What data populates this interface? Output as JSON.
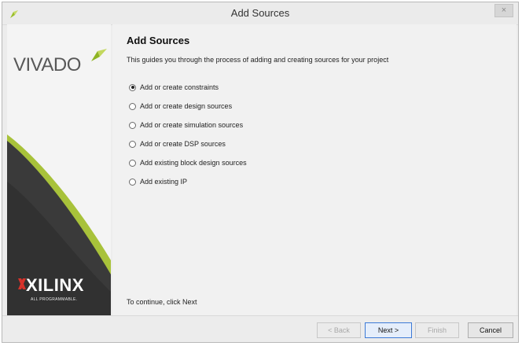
{
  "window": {
    "title": "Add Sources",
    "close_label": "×"
  },
  "branding": {
    "vivado_label": "VIVADO",
    "xilinx_label": "XILINX",
    "xilinx_tagline": "ALL PROGRAMMABLE."
  },
  "page": {
    "heading": "Add Sources",
    "subtitle": "This guides you through the process of adding and creating sources for your project",
    "continue_hint": "To continue, click Next"
  },
  "options": [
    {
      "label": "Add or create constraints",
      "checked": true
    },
    {
      "label": "Add or create design sources",
      "checked": false
    },
    {
      "label": "Add or create simulation sources",
      "checked": false
    },
    {
      "label": "Add or create DSP sources",
      "checked": false
    },
    {
      "label": "Add existing block design sources",
      "checked": false
    },
    {
      "label": "Add existing IP",
      "checked": false
    }
  ],
  "buttons": {
    "back": "< Back",
    "next": "Next >",
    "finish": "Finish",
    "cancel": "Cancel"
  },
  "colors": {
    "sidebar_dark": "#3a3a3a",
    "sidebar_accent": "#a8c23a",
    "xilinx_red": "#d6322a"
  }
}
